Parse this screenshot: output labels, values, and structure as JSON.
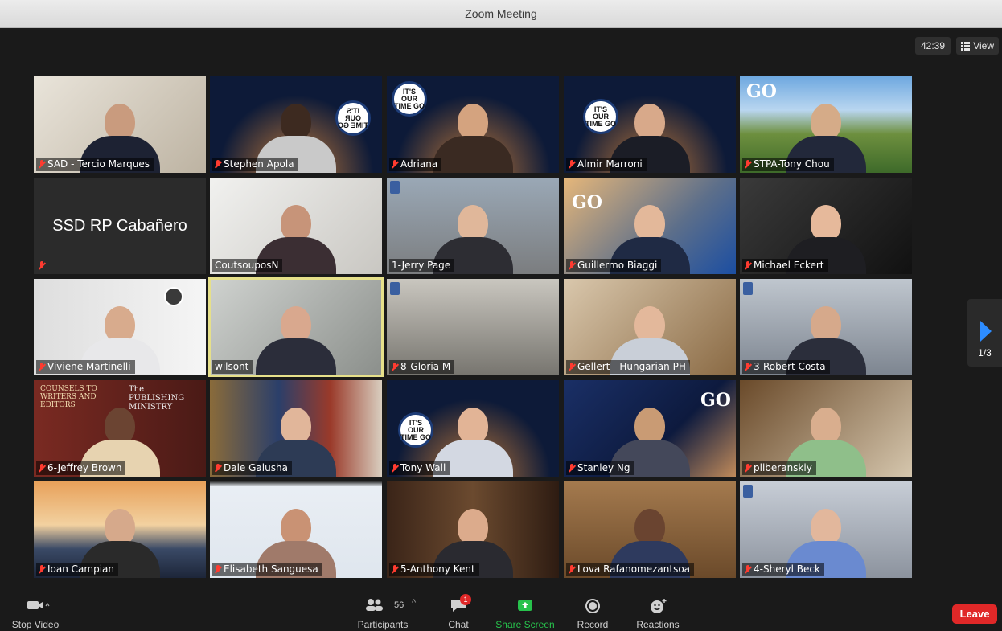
{
  "window": {
    "title": "Zoom Meeting"
  },
  "meeting": {
    "timer": "42:39",
    "view_label": "View",
    "page_indicator": "1/3"
  },
  "participants_tiles": [
    {
      "name": "SAD - Tercio Marques"
    },
    {
      "name": "Stephen Apola",
      "badge": "IT'S OUR TIME GO"
    },
    {
      "name": "Adriana",
      "badge": "IT'S OUR TIME GO"
    },
    {
      "name": "Almir Marroni",
      "badge": "IT'S OUR TIME GO"
    },
    {
      "name": "STPA-Tony Chou",
      "logo": "GO"
    },
    {
      "name": "SSD RP Cabañero"
    },
    {
      "name": "CoutsouposN"
    },
    {
      "name": "1-Jerry Page"
    },
    {
      "name": "Guillermo Biaggi",
      "logo": "GO"
    },
    {
      "name": "Michael Eckert"
    },
    {
      "name": "Viviene Martinelli"
    },
    {
      "name": "wilsont"
    },
    {
      "name": "8-Gloria M"
    },
    {
      "name": "Gellert - Hungarian PH"
    },
    {
      "name": "3-Robert Costa"
    },
    {
      "name": "6-Jeffrey Brown",
      "bg_text_1": "COUNSELS TO WRITERS AND EDITORS",
      "bg_text_2": "The PUBLISHING MINISTRY"
    },
    {
      "name": "Dale Galusha"
    },
    {
      "name": "Tony Wall",
      "badge": "IT'S OUR TIME GO"
    },
    {
      "name": "Stanley Ng",
      "logo": "GO"
    },
    {
      "name": "pliberanskiy"
    },
    {
      "name": "Ioan Campian"
    },
    {
      "name": "Elisabeth Sanguesa"
    },
    {
      "name": "5-Anthony Kent"
    },
    {
      "name": "Lova Rafanomezantsoa"
    },
    {
      "name": "4-Sheryl Beck"
    }
  ],
  "toolbar": {
    "stop_video": "Stop Video",
    "participants": "Participants",
    "participants_count": "56",
    "chat": "Chat",
    "chat_badge": "1",
    "share_screen": "Share Screen",
    "record": "Record",
    "reactions": "Reactions",
    "leave": "Leave"
  },
  "colors": {
    "background": "#1a1a1a",
    "share_green": "#27c24c",
    "leave_red": "#e02828",
    "accent_blue": "#2d8cff",
    "active_speaker": "#e6e08a"
  }
}
